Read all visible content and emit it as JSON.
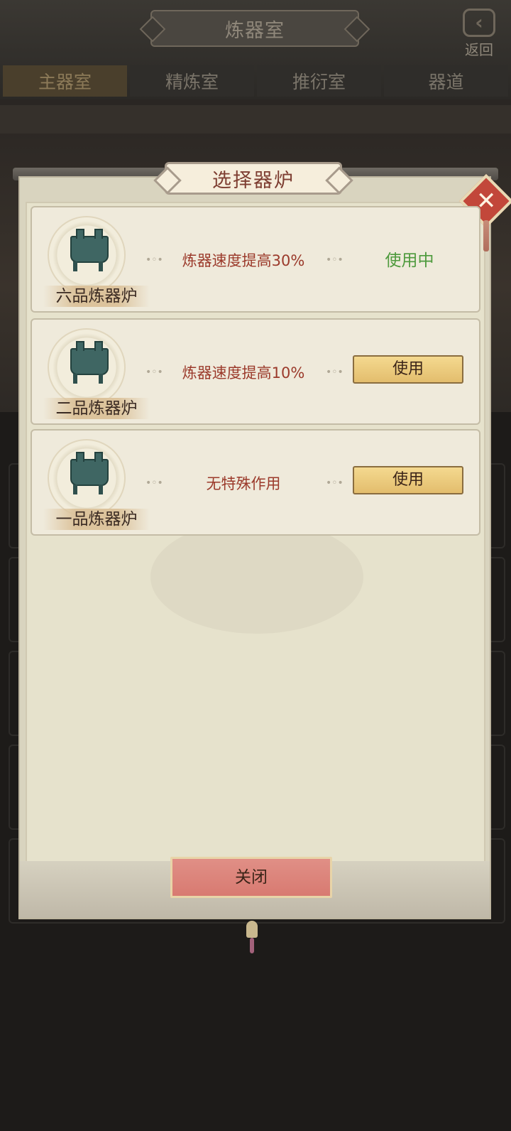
{
  "header": {
    "title": "炼器室",
    "back_label": "返回",
    "back_icon": "back-arrow-icon"
  },
  "tabs": [
    {
      "label": "主器室",
      "active": true
    },
    {
      "label": "精炼室",
      "active": false
    },
    {
      "label": "推衍室",
      "active": false
    },
    {
      "label": "器道",
      "active": false
    }
  ],
  "modal": {
    "title": "选择器炉",
    "close_icon": "close-x-icon",
    "close_button_label": "关闭",
    "furnaces": [
      {
        "name": "六品炼器炉",
        "effect": "炼器速度提高30%",
        "status": "使用中",
        "status_color": "#4e9a3d"
      },
      {
        "name": "二品炼器炉",
        "effect": "炼器速度提高10%",
        "action_label": "使用"
      },
      {
        "name": "一品炼器炉",
        "effect": "无特殊作用",
        "action_label": "使用"
      }
    ]
  },
  "colors": {
    "accent_red": "#9b3a2b",
    "in_use_green": "#4e9a3d",
    "button_gold": "#e3bd6d",
    "close_button_pink": "#d87a71"
  }
}
